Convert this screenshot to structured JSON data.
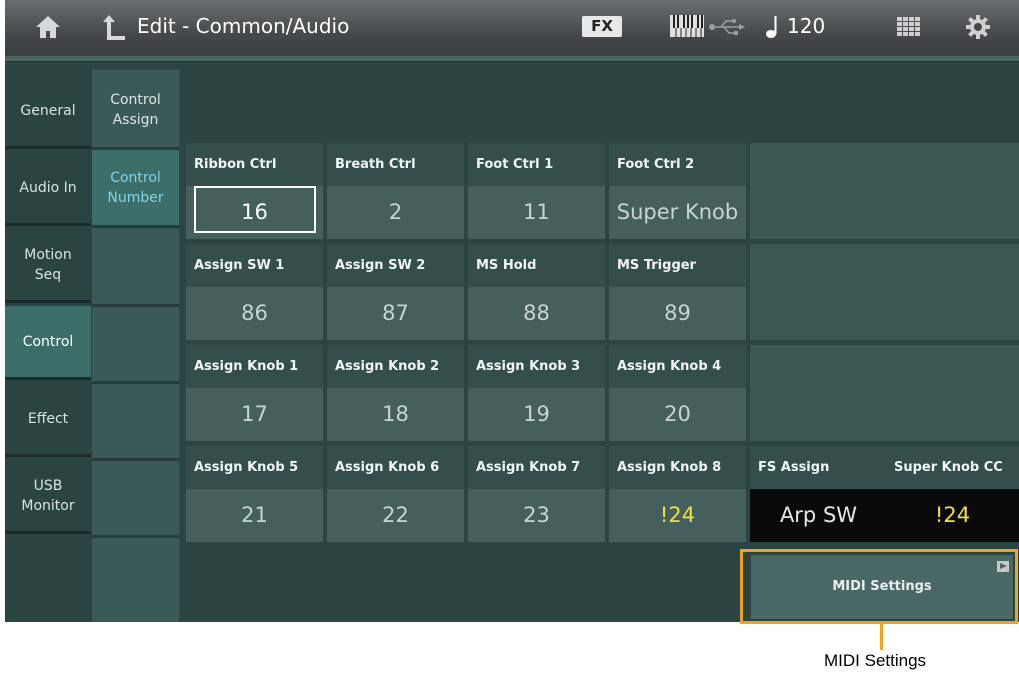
{
  "topbar": {
    "title": "Edit - Common/Audio",
    "fx_label": "FX",
    "tempo": "120",
    "icons": [
      "home-icon",
      "back-icon",
      "keyboard-icon",
      "usb-icon",
      "note-icon",
      "grid-icon",
      "gear-icon"
    ]
  },
  "tabs": [
    {
      "label": "General"
    },
    {
      "label": "Audio In"
    },
    {
      "label": "Motion\nSeq"
    },
    {
      "label": "Control",
      "active": true
    },
    {
      "label": "Effect"
    },
    {
      "label": "USB\nMonitor"
    }
  ],
  "subtabs": [
    {
      "label": "Control\nAssign"
    },
    {
      "label": "Control\nNumber",
      "active": true
    }
  ],
  "grid": [
    [
      {
        "label": "Ribbon Ctrl",
        "value": "16",
        "selected": true
      },
      {
        "label": "Breath Ctrl",
        "value": "2"
      },
      {
        "label": "Foot Ctrl 1",
        "value": "11"
      },
      {
        "label": "Foot Ctrl 2",
        "value": "Super Knob"
      }
    ],
    [
      {
        "label": "Assign SW 1",
        "value": "86"
      },
      {
        "label": "Assign SW 2",
        "value": "87"
      },
      {
        "label": "MS Hold",
        "value": "88"
      },
      {
        "label": "MS Trigger",
        "value": "89"
      }
    ],
    [
      {
        "label": "Assign Knob 1",
        "value": "17"
      },
      {
        "label": "Assign Knob 2",
        "value": "18"
      },
      {
        "label": "Assign Knob 3",
        "value": "19"
      },
      {
        "label": "Assign Knob 4",
        "value": "20"
      }
    ],
    [
      {
        "label": "Assign Knob 5",
        "value": "21"
      },
      {
        "label": "Assign Knob 6",
        "value": "22"
      },
      {
        "label": "Assign Knob 7",
        "value": "23"
      },
      {
        "label": "Assign Knob 8",
        "value": "!24",
        "warning": true
      }
    ]
  ],
  "extra": {
    "fs_assign": {
      "label": "FS Assign",
      "value": "Arp SW"
    },
    "super_knob_cc": {
      "label": "Super Knob CC",
      "value": "!24"
    }
  },
  "midi_button": {
    "label": "MIDI Settings"
  },
  "callout": {
    "label": "MIDI Settings"
  },
  "colors": {
    "accent": "#7fd3ea",
    "warning": "#f0e03a",
    "highlight": "#f5a21b",
    "background": "#2b4542"
  }
}
